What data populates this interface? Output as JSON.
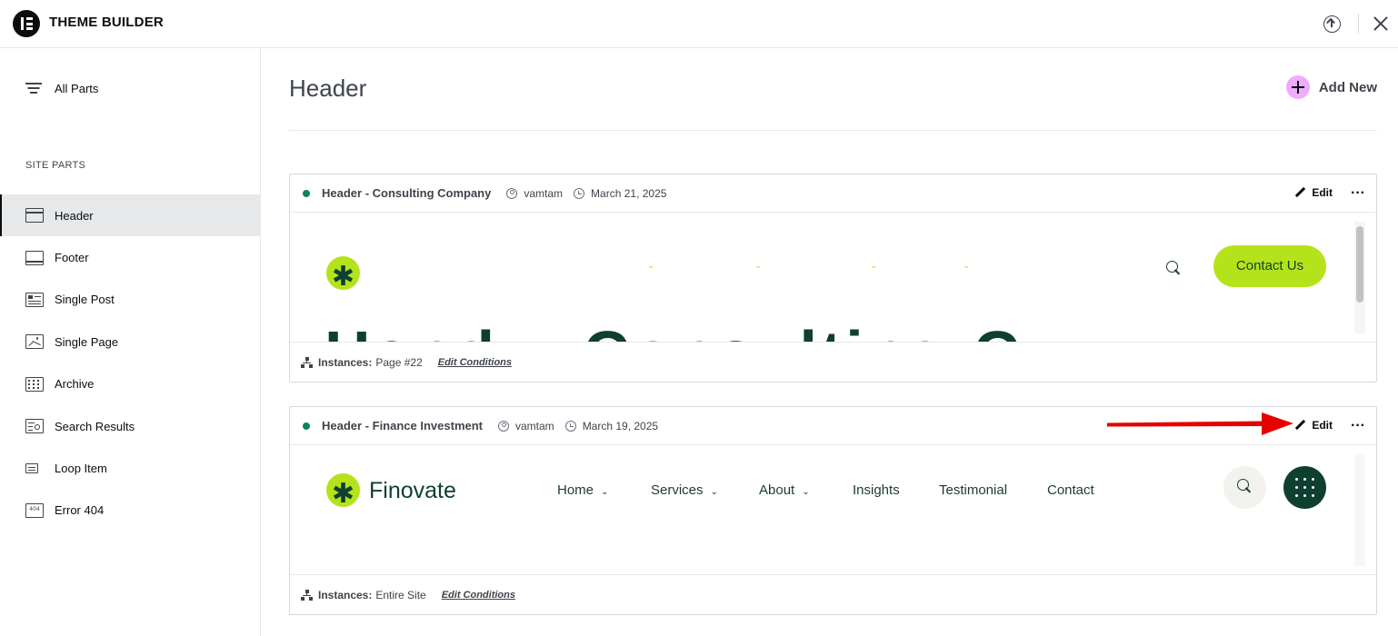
{
  "app": {
    "title": "THEME BUILDER"
  },
  "sidebar": {
    "all_parts": "All Parts",
    "section_label": "SITE PARTS",
    "items": [
      {
        "label": "Header",
        "icon": "header-icon",
        "active": true
      },
      {
        "label": "Footer",
        "icon": "footer-icon",
        "active": false
      },
      {
        "label": "Single Post",
        "icon": "single-post-icon",
        "active": false
      },
      {
        "label": "Single Page",
        "icon": "single-page-icon",
        "active": false
      },
      {
        "label": "Archive",
        "icon": "archive-icon",
        "active": false
      },
      {
        "label": "Search Results",
        "icon": "search-results-icon",
        "active": false
      },
      {
        "label": "Loop Item",
        "icon": "loop-item-icon",
        "active": false
      },
      {
        "label": "Error 404",
        "icon": "error-404-icon",
        "active": false
      }
    ]
  },
  "main": {
    "title": "Header",
    "add_new": "Add New",
    "cards": [
      {
        "title": "Header - Consulting Company",
        "author": "vamtam",
        "date": "March 21, 2025",
        "edit_label": "Edit",
        "more_label": "···",
        "instances_label": "Instances:",
        "instances_value": "Page #22",
        "edit_conditions": "Edit Conditions",
        "preview": {
          "logo_glyph": "✱",
          "cta_label": "Contact Us",
          "big_text": "Hand... Consulting C...",
          "chevron": "⌄"
        }
      },
      {
        "title": "Header - Finance Investment",
        "author": "vamtam",
        "date": "March 19, 2025",
        "edit_label": "Edit",
        "more_label": "···",
        "instances_label": "Instances:",
        "instances_value": "Entire Site",
        "edit_conditions": "Edit Conditions",
        "preview": {
          "logo_glyph": "✱",
          "brand": "Finovate",
          "nav": [
            {
              "label": "Home",
              "has_chevron": true
            },
            {
              "label": "Services",
              "has_chevron": true
            },
            {
              "label": "About",
              "has_chevron": true
            },
            {
              "label": "Insights",
              "has_chevron": false
            },
            {
              "label": "Testimonial",
              "has_chevron": false
            },
            {
              "label": "Contact",
              "has_chevron": false
            }
          ],
          "chevron": "⌄"
        }
      }
    ]
  },
  "colors": {
    "accent_pink": "#f0abfc",
    "status_green": "#0a875a",
    "brand_lime": "#b5e31b",
    "brand_dark_green": "#0f3f31",
    "annotation_arrow": "#e60000"
  }
}
